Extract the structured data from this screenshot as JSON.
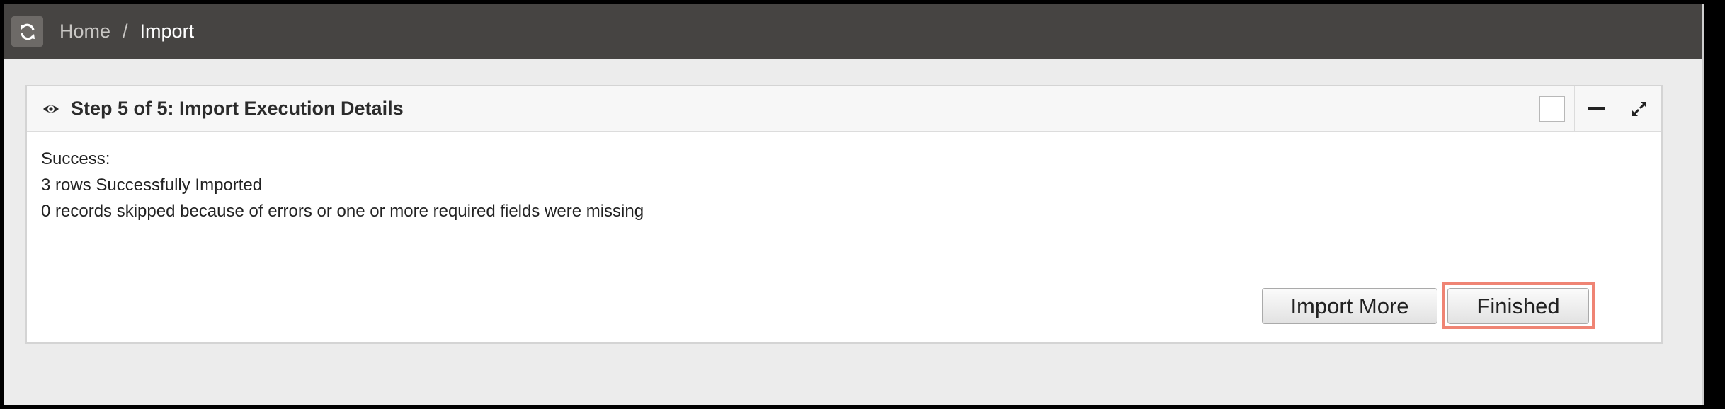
{
  "header": {
    "refresh_icon": "refresh-icon",
    "breadcrumb": {
      "home": "Home",
      "separator": "/",
      "current": "Import"
    }
  },
  "panel": {
    "title": "Step 5 of 5: Import Execution Details",
    "title_icon": "eye-icon",
    "controls": [
      "checkbox",
      "minimize-icon",
      "expand-icon"
    ],
    "body": {
      "line1": "Success:",
      "line2": "3 rows Successfully Imported",
      "line3": "0 records skipped because of errors or one or more required fields were missing"
    },
    "buttons": {
      "import_more": "Import More",
      "finished": "Finished"
    }
  },
  "colors": {
    "topbar": "#464442",
    "highlight": "#ef8474",
    "page_bg": "#ececec"
  }
}
